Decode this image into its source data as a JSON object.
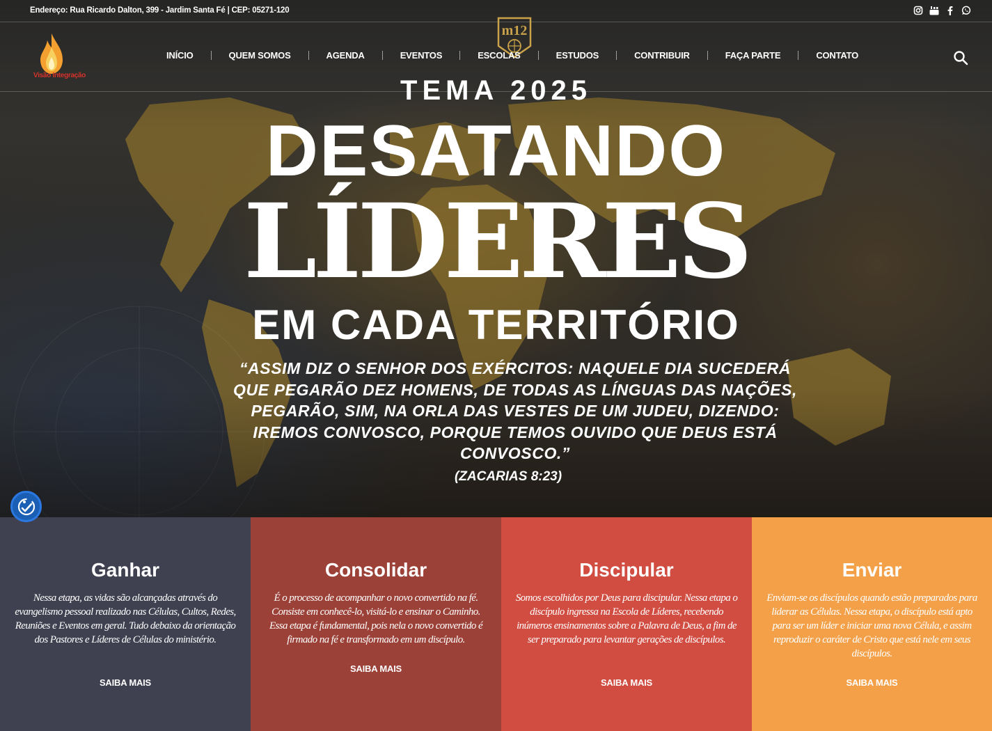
{
  "topbar": {
    "address": "Endereço: Rua Ricardo Dalton, 399 - Jardim Santa Fé | CEP: 05271-120",
    "socials": [
      "instagram-icon",
      "youtube-icon",
      "facebook-icon",
      "whatsapp-icon"
    ]
  },
  "logo": {
    "text": "Visão Integração"
  },
  "badge": {
    "text": "m12"
  },
  "nav": {
    "items": [
      "INÍCIO",
      "QUEM SOMOS",
      "AGENDA",
      "EVENTOS",
      "ESCOLAS",
      "ESTUDOS",
      "CONTRIBUIR",
      "FAÇA PARTE",
      "CONTATO"
    ]
  },
  "hero": {
    "tema": "TEMA 2025",
    "line1": "DESATANDO",
    "line2": "LÍDERES",
    "line3": "EM CADA TERRITÓRIO",
    "verse": "“ASSIM DIZ O SENHOR DOS EXÉRCITOS: NAQUELE DIA SUCEDERÁ QUE PEGARÃO DEZ HOMENS, DE TODAS AS LÍNGUAS DAS NAÇÕES, PEGARÃO, SIM, NA ORLA DAS VESTES DE UM JUDEU, DIZENDO: IREMOS CONVOSCO, PORQUE TEMOS OUVIDO QUE DEUS ESTÁ CONVOSCO.”",
    "reference": "(ZACARIAS 8:23)"
  },
  "cards": [
    {
      "title": "Ganhar",
      "text": "Nessa etapa, as vidas são alcançadas através do evangelismo pessoal realizado nas Células, Cultos, Redes, Reuniões e Eventos em geral. Tudo debaixo da orientação dos Pastores e Líderes de Células do ministério.",
      "link": "SAIBA MAIS",
      "color": "#3f4150"
    },
    {
      "title": "Consolidar",
      "text": "É o processo de acompanhar o novo convertido na fé. Consiste em conhecê-lo, visitá-lo e ensinar o Caminho. Essa etapa é fundamental, pois nela o novo convertido é firmado na fé e transformado em um discípulo.",
      "link": "SAIBA MAIS",
      "color": "#9c4138"
    },
    {
      "title": "Discipular",
      "text": "Somos escolhidos por Deus para discipular. Nessa etapa o discípulo ingressa na Escola de Líderes, recebendo inúmeros ensinamentos sobre a Palavra de Deus, a fim de ser preparado para levantar gerações de discípulos.",
      "link": "SAIBA MAIS",
      "color": "#d14c41"
    },
    {
      "title": "Enviar",
      "text": "Enviam-se os discípulos quando estão preparados para liderar as Células. Nessa etapa, o discípulo está apto para ser um líder e iniciar uma nova Célula, e assim reproduzir o caráter de Cristo que está nele em seus discípulos.",
      "link": "SAIBA MAIS",
      "color": "#f4a049"
    }
  ]
}
